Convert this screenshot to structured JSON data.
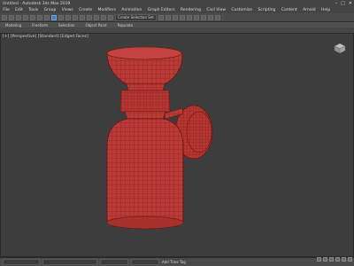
{
  "window": {
    "title": "Untitled - Autodesk 3ds Max 2019",
    "controls": [
      "–",
      "□",
      "✕"
    ]
  },
  "menu": [
    "File",
    "Edit",
    "Tools",
    "Group",
    "Views",
    "Create",
    "Modifiers",
    "Animation",
    "Graph Editors",
    "Rendering",
    "Civil View",
    "Customize",
    "Scripting",
    "Content",
    "Arnold",
    "Help"
  ],
  "toolbar": {
    "selection_set": "Create Selection Set"
  },
  "ribbon": {
    "tabs": [
      "Modeling",
      "Freeform",
      "Selection",
      "Object Paint",
      "Populate"
    ]
  },
  "viewport": {
    "label": "[+] [Perspective] [Standard] [Edged Faces]"
  },
  "status": {
    "grid": "Add Time Tag"
  },
  "colors": {
    "mesh_fill": "#b93a36",
    "mesh_wire": "#7a1916",
    "accent": "#4a7fbf"
  },
  "icons": {
    "viewcube": "viewcube-icon",
    "search": "search-icon"
  }
}
